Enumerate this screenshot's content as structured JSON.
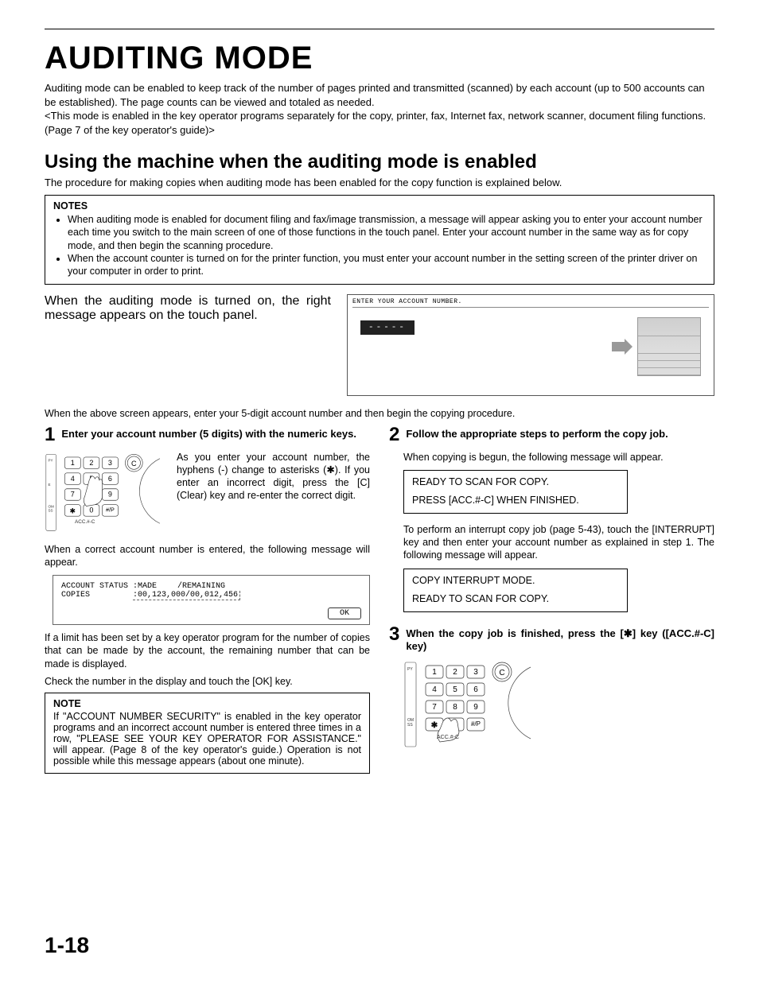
{
  "page_number": "1-18",
  "title": "AUDITING MODE",
  "intro": "Auditing mode can be enabled to keep track of the number of pages printed and transmitted (scanned) by each account (up to 500 accounts can be established). The page counts can be viewed and totaled as needed.\n<This mode is enabled in the key operator programs separately for the copy, printer, fax, Internet fax, network scanner, document filing functions. (Page 7 of the key operator's guide)>",
  "subhead": "Using the machine when the auditing mode is enabled",
  "lead": "The procedure for making copies when auditing mode has been enabled for the copy function is explained below.",
  "notes_title": "NOTES",
  "notes": [
    "When auditing mode is enabled for document filing and fax/image transmission, a message will appear asking you to enter your account number each time you switch to the main screen of one of those functions in the touch panel. Enter your account number in the same way as for copy mode, and then begin the scanning procedure.",
    "When the account counter is turned on for the printer function, you must enter your account number in the setting screen of the printer driver on your computer in order to print."
  ],
  "panel_intro_left": "When the auditing mode is turned on, the right message appears on the touch panel.",
  "panel_header": "ENTER YOUR ACCOUNT NUMBER.",
  "panel_dashes": "-----",
  "after_screen": "When the above screen appears, enter your 5-digit account number and then begin the copying procedure.",
  "step1_title": "Enter your account number (5 digits) with the numeric keys.",
  "step1_desc": "As you enter your account number, the hyphens (-) change to asterisks (✱). If you enter an incorrect digit, press the [C] (Clear) key and re-enter the correct digit.",
  "step1_after1": "When a correct account number is entered, the following message will appear.",
  "status_line1a": "ACCOUNT STATUS",
  "status_line1b": ":MADE",
  "status_line1c": "/REMAINING",
  "status_line2a": "COPIES",
  "status_line2b": ":00,123,000/00,012,456",
  "status_ok": "OK",
  "step1_after2": "If a limit has been set by a key operator program for the number of copies that can be made by the account, the remaining number that can be made is displayed.",
  "step1_after3": "Check the number in the display and touch the [OK] key.",
  "note_single_title": "NOTE",
  "note_single": "If \"ACCOUNT NUMBER SECURITY\" is enabled in the key operator programs and an incorrect account number is entered three times in a row, \"PLEASE SEE YOUR KEY OPERATOR FOR ASSISTANCE.\" will appear. (Page 8 of the key operator's guide.) Operation is not possible while this message appears (about one minute).",
  "step2_title": "Follow the appropriate steps to perform the copy job.",
  "step2_desc": "When copying is begun, the following message will appear.",
  "msgbox1_l1": "READY TO SCAN FOR COPY.",
  "msgbox1_l2": "PRESS [ACC.#-C] WHEN FINISHED.",
  "step2_after": "To perform an interrupt copy job (page 5-43), touch the [INTERRUPT] key and then enter your account number as explained in step 1. The following message will appear.",
  "msgbox2_l1": "COPY INTERRUPT MODE.",
  "msgbox2_l2": "READY TO SCAN FOR COPY.",
  "step3_title": "When the copy job is finished, press the [✱] key ([ACC.#-C] key)",
  "keypad": {
    "rows": [
      [
        "1",
        "2",
        "3"
      ],
      [
        "4",
        "5",
        "6"
      ],
      [
        "7",
        "8",
        "9"
      ],
      [
        "✱",
        "0",
        "#/P"
      ]
    ],
    "clear": "C",
    "label": "ACC.#-C"
  }
}
